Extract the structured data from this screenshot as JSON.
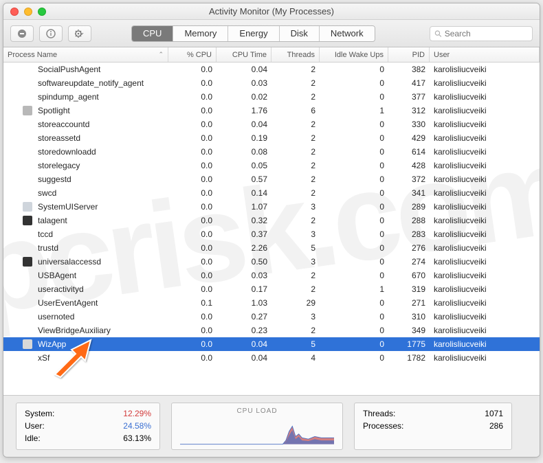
{
  "window": {
    "title": "Activity Monitor (My Processes)"
  },
  "toolbar": {
    "stop_icon": "stop-icon",
    "info_icon": "info-icon",
    "gear_icon": "gear-icon"
  },
  "tabs": [
    "CPU",
    "Memory",
    "Energy",
    "Disk",
    "Network"
  ],
  "active_tab": 0,
  "search": {
    "placeholder": "Search"
  },
  "columns": {
    "name": "Process Name",
    "cpu": "% CPU",
    "time": "CPU Time",
    "threads": "Threads",
    "idle": "Idle Wake Ups",
    "pid": "PID",
    "user": "User"
  },
  "rows": [
    {
      "name": "SocialPushAgent",
      "cpu": "0.0",
      "time": "0.04",
      "threads": "2",
      "idle": "0",
      "pid": "382",
      "user": "karolisliucveiki",
      "icon": ""
    },
    {
      "name": "softwareupdate_notify_agent",
      "cpu": "0.0",
      "time": "0.03",
      "threads": "2",
      "idle": "0",
      "pid": "417",
      "user": "karolisliucveiki",
      "icon": ""
    },
    {
      "name": "spindump_agent",
      "cpu": "0.0",
      "time": "0.02",
      "threads": "2",
      "idle": "0",
      "pid": "377",
      "user": "karolisliucveiki",
      "icon": ""
    },
    {
      "name": "Spotlight",
      "cpu": "0.0",
      "time": "1.76",
      "threads": "6",
      "idle": "1",
      "pid": "312",
      "user": "karolisliucveiki",
      "icon": "spotlight"
    },
    {
      "name": "storeaccountd",
      "cpu": "0.0",
      "time": "0.04",
      "threads": "2",
      "idle": "0",
      "pid": "330",
      "user": "karolisliucveiki",
      "icon": ""
    },
    {
      "name": "storeassetd",
      "cpu": "0.0",
      "time": "0.19",
      "threads": "2",
      "idle": "0",
      "pid": "429",
      "user": "karolisliucveiki",
      "icon": ""
    },
    {
      "name": "storedownloadd",
      "cpu": "0.0",
      "time": "0.08",
      "threads": "2",
      "idle": "0",
      "pid": "614",
      "user": "karolisliucveiki",
      "icon": ""
    },
    {
      "name": "storelegacy",
      "cpu": "0.0",
      "time": "0.05",
      "threads": "2",
      "idle": "0",
      "pid": "428",
      "user": "karolisliucveiki",
      "icon": ""
    },
    {
      "name": "suggestd",
      "cpu": "0.0",
      "time": "0.57",
      "threads": "2",
      "idle": "0",
      "pid": "372",
      "user": "karolisliucveiki",
      "icon": ""
    },
    {
      "name": "swcd",
      "cpu": "0.0",
      "time": "0.14",
      "threads": "2",
      "idle": "0",
      "pid": "341",
      "user": "karolisliucveiki",
      "icon": ""
    },
    {
      "name": "SystemUIServer",
      "cpu": "0.0",
      "time": "1.07",
      "threads": "3",
      "idle": "0",
      "pid": "289",
      "user": "karolisliucveiki",
      "icon": "sysui"
    },
    {
      "name": "talagent",
      "cpu": "0.0",
      "time": "0.32",
      "threads": "2",
      "idle": "0",
      "pid": "288",
      "user": "karolisliucveiki",
      "icon": "tal"
    },
    {
      "name": "tccd",
      "cpu": "0.0",
      "time": "0.37",
      "threads": "3",
      "idle": "0",
      "pid": "283",
      "user": "karolisliucveiki",
      "icon": ""
    },
    {
      "name": "trustd",
      "cpu": "0.0",
      "time": "2.26",
      "threads": "5",
      "idle": "0",
      "pid": "276",
      "user": "karolisliucveiki",
      "icon": ""
    },
    {
      "name": "universalaccessd",
      "cpu": "0.0",
      "time": "0.50",
      "threads": "3",
      "idle": "0",
      "pid": "274",
      "user": "karolisliucveiki",
      "icon": "ua"
    },
    {
      "name": "USBAgent",
      "cpu": "0.0",
      "time": "0.03",
      "threads": "2",
      "idle": "0",
      "pid": "670",
      "user": "karolisliucveiki",
      "icon": ""
    },
    {
      "name": "useractivityd",
      "cpu": "0.0",
      "time": "0.17",
      "threads": "2",
      "idle": "1",
      "pid": "319",
      "user": "karolisliucveiki",
      "icon": ""
    },
    {
      "name": "UserEventAgent",
      "cpu": "0.1",
      "time": "1.03",
      "threads": "29",
      "idle": "0",
      "pid": "271",
      "user": "karolisliucveiki",
      "icon": ""
    },
    {
      "name": "usernoted",
      "cpu": "0.0",
      "time": "0.27",
      "threads": "3",
      "idle": "0",
      "pid": "310",
      "user": "karolisliucveiki",
      "icon": ""
    },
    {
      "name": "ViewBridgeAuxiliary",
      "cpu": "0.0",
      "time": "0.23",
      "threads": "2",
      "idle": "0",
      "pid": "349",
      "user": "karolisliucveiki",
      "icon": ""
    },
    {
      "name": "WizApp",
      "cpu": "0.0",
      "time": "0.04",
      "threads": "5",
      "idle": "0",
      "pid": "1775",
      "user": "karolisliucveiki",
      "icon": "wiz",
      "selected": true
    },
    {
      "name": "xSf",
      "cpu": "0.0",
      "time": "0.04",
      "threads": "4",
      "idle": "0",
      "pid": "1782",
      "user": "karolisliucveiki",
      "icon": ""
    }
  ],
  "stats": {
    "system_label": "System:",
    "system_value": "12.29%",
    "user_label": "User:",
    "user_value": "24.58%",
    "idle_label": "Idle:",
    "idle_value": "63.13%"
  },
  "load": {
    "title": "CPU LOAD"
  },
  "procs": {
    "threads_label": "Threads:",
    "threads_value": "1071",
    "processes_label": "Processes:",
    "processes_value": "286"
  },
  "icon_colors": {
    "spotlight": "#b8b8b8",
    "sysui": "#cfd5dc",
    "tal": "#333333",
    "ua": "#333333",
    "wiz": "#d8d8d8"
  },
  "watermark": "pcrisk.com"
}
